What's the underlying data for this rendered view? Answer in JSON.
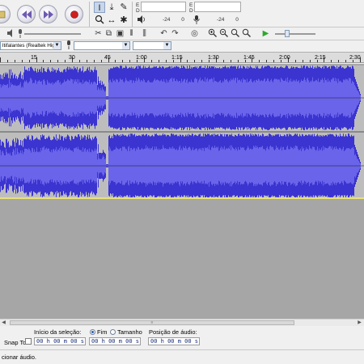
{
  "colors": {
    "waveform": "#3b34d0",
    "waveform_rms": "#6a64ea",
    "track_bg": "#bdbdbd",
    "empty_area": "#a6a6a6",
    "center_line": "#1a1a1a",
    "track_separator": "#e8e07a"
  },
  "transport": {
    "buttons": [
      {
        "name": "pause",
        "icon": "pause-icon"
      },
      {
        "name": "skip-start",
        "icon": "skip-to-start-icon"
      },
      {
        "name": "skip-end",
        "icon": "skip-to-end-icon"
      },
      {
        "name": "record",
        "icon": "record-icon"
      }
    ]
  },
  "tools": [
    "I",
    "⤓",
    "✎",
    "🔍",
    "↔",
    "✱"
  ],
  "meters": {
    "output": {
      "L": "E",
      "R": "D",
      "ticks": [
        "-24",
        "0"
      ]
    },
    "input": {
      "L": "E",
      "R": "D",
      "ticks": [
        "-24",
        "0"
      ]
    }
  },
  "device": {
    "playback": "ltifalantes (Realtek High",
    "recording": ""
  },
  "ruler": {
    "labels": [
      "15",
      "30",
      "45",
      "1:00",
      "1:15",
      "1:30",
      "1:45",
      "2:00",
      "2:15",
      "2:30"
    ]
  },
  "selection": {
    "snap_to": "Snap To",
    "start_label": "Início da seleção:",
    "end_label": "Fim",
    "length_label": "Tamanho",
    "position_label": "Posição de áudio:",
    "start_value": "00 h 00 m 00 s",
    "end_value": "00 h 00 m 00 s",
    "position_value": "00 h 00 m 00 s"
  },
  "status": {
    "text": "cionar áudio."
  }
}
